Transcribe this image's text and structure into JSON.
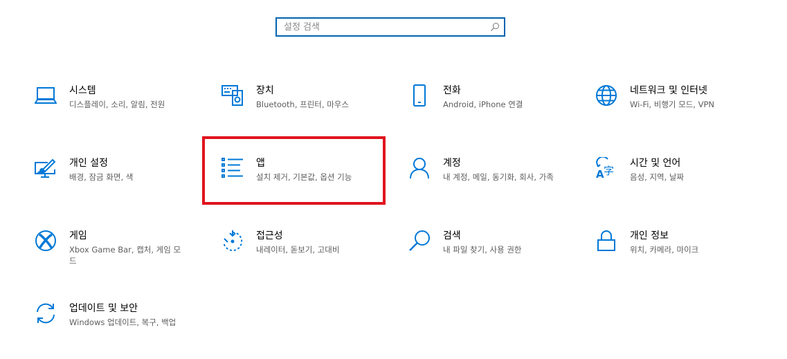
{
  "search": {
    "placeholder": "설정 검색",
    "value": ""
  },
  "tiles": [
    {
      "id": "system",
      "title": "시스템",
      "desc": "디스플레이, 소리, 알림, 전원",
      "icon": "laptop-icon"
    },
    {
      "id": "devices",
      "title": "장치",
      "desc": "Bluetooth, 프린터, 마우스",
      "icon": "keyboard-speaker-icon"
    },
    {
      "id": "phone",
      "title": "전화",
      "desc": "Android, iPhone 연결",
      "icon": "phone-icon"
    },
    {
      "id": "network",
      "title": "네트워크 및 인터넷",
      "desc": "Wi-Fi, 비행기 모드, VPN",
      "icon": "globe-icon"
    },
    {
      "id": "personalization",
      "title": "개인 설정",
      "desc": "배경, 잠금 화면, 색",
      "icon": "monitor-brush-icon"
    },
    {
      "id": "apps",
      "title": "앱",
      "desc": "설치 제거, 기본값, 옵션 기능",
      "icon": "apps-list-icon"
    },
    {
      "id": "accounts",
      "title": "계정",
      "desc": "내 계정, 메일, 동기화, 회사, 가족",
      "icon": "person-icon"
    },
    {
      "id": "time-language",
      "title": "시간 및 언어",
      "desc": "음성, 지역, 날짜",
      "icon": "language-icon"
    },
    {
      "id": "gaming",
      "title": "게임",
      "desc": "Xbox Game Bar, 캡처, 게임 모드",
      "icon": "xbox-icon"
    },
    {
      "id": "ease-of-access",
      "title": "접근성",
      "desc": "내레이터, 돋보기, 고대비",
      "icon": "ease-of-access-icon"
    },
    {
      "id": "search",
      "title": "검색",
      "desc": "내 파일 찾기, 사용 권한",
      "icon": "magnifier-icon"
    },
    {
      "id": "privacy",
      "title": "개인 정보",
      "desc": "위치, 카메라, 마이크",
      "icon": "lock-icon"
    },
    {
      "id": "update-security",
      "title": "업데이트 및 보안",
      "desc": "Windows 업데이트, 복구, 백업",
      "icon": "sync-icon"
    }
  ],
  "colors": {
    "accent": "#0063b1",
    "icon": "#0078d7",
    "highlight": "#e0141e",
    "description": "#5d5d5d"
  }
}
